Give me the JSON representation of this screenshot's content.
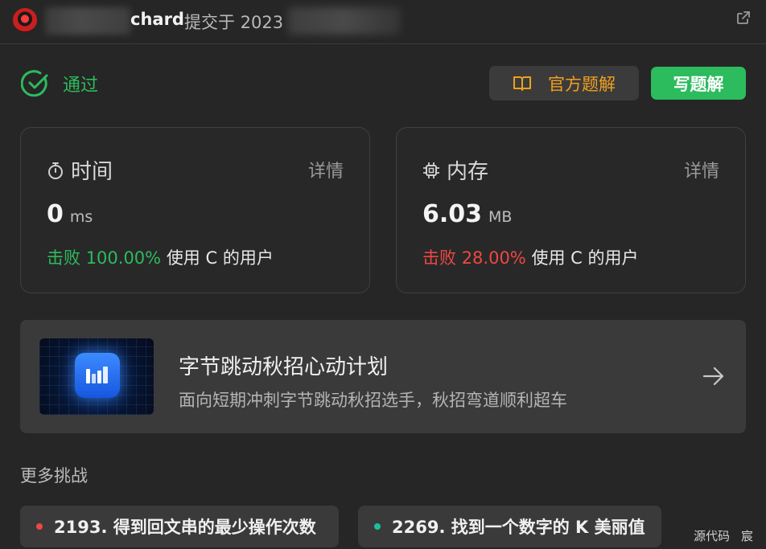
{
  "header": {
    "submitter_partial": "chard",
    "submitted_text": "提交于 2023"
  },
  "status": {
    "label": "通过",
    "color": "#2cbb5d"
  },
  "buttons": {
    "official_solution": "官方题解",
    "write_solution": "写题解"
  },
  "time_card": {
    "title": "时间",
    "detail": "详情",
    "value": "0",
    "unit": "ms",
    "beat_prefix": "击败",
    "beat_percent": "100.00%",
    "beat_suffix": "使用 C 的用户"
  },
  "memory_card": {
    "title": "内存",
    "detail": "详情",
    "value": "6.03",
    "unit": "MB",
    "beat_prefix": "击败",
    "beat_percent": "28.00%",
    "beat_suffix": "使用 C 的用户"
  },
  "promo": {
    "title": "字节跳动秋招心动计划",
    "subtitle": "面向短期冲刺字节跳动秋招选手，秋招弯道顺利超车"
  },
  "more_challenges": {
    "title": "更多挑战",
    "items": [
      {
        "label": "2193. 得到回文串的最少操作次数",
        "difficulty_color": "#ef4743"
      },
      {
        "label": "2269. 找到一个数字的 K 美丽值",
        "difficulty_color": "#1bbfa0"
      }
    ]
  },
  "footer": {
    "link1": "源代码",
    "link2": "宸"
  },
  "icons": {
    "status": "check-circle-icon",
    "official": "book-open-icon",
    "time": "stopwatch-icon",
    "memory": "chip-icon",
    "share": "share-icon",
    "arrow": "arrow-right-icon"
  }
}
